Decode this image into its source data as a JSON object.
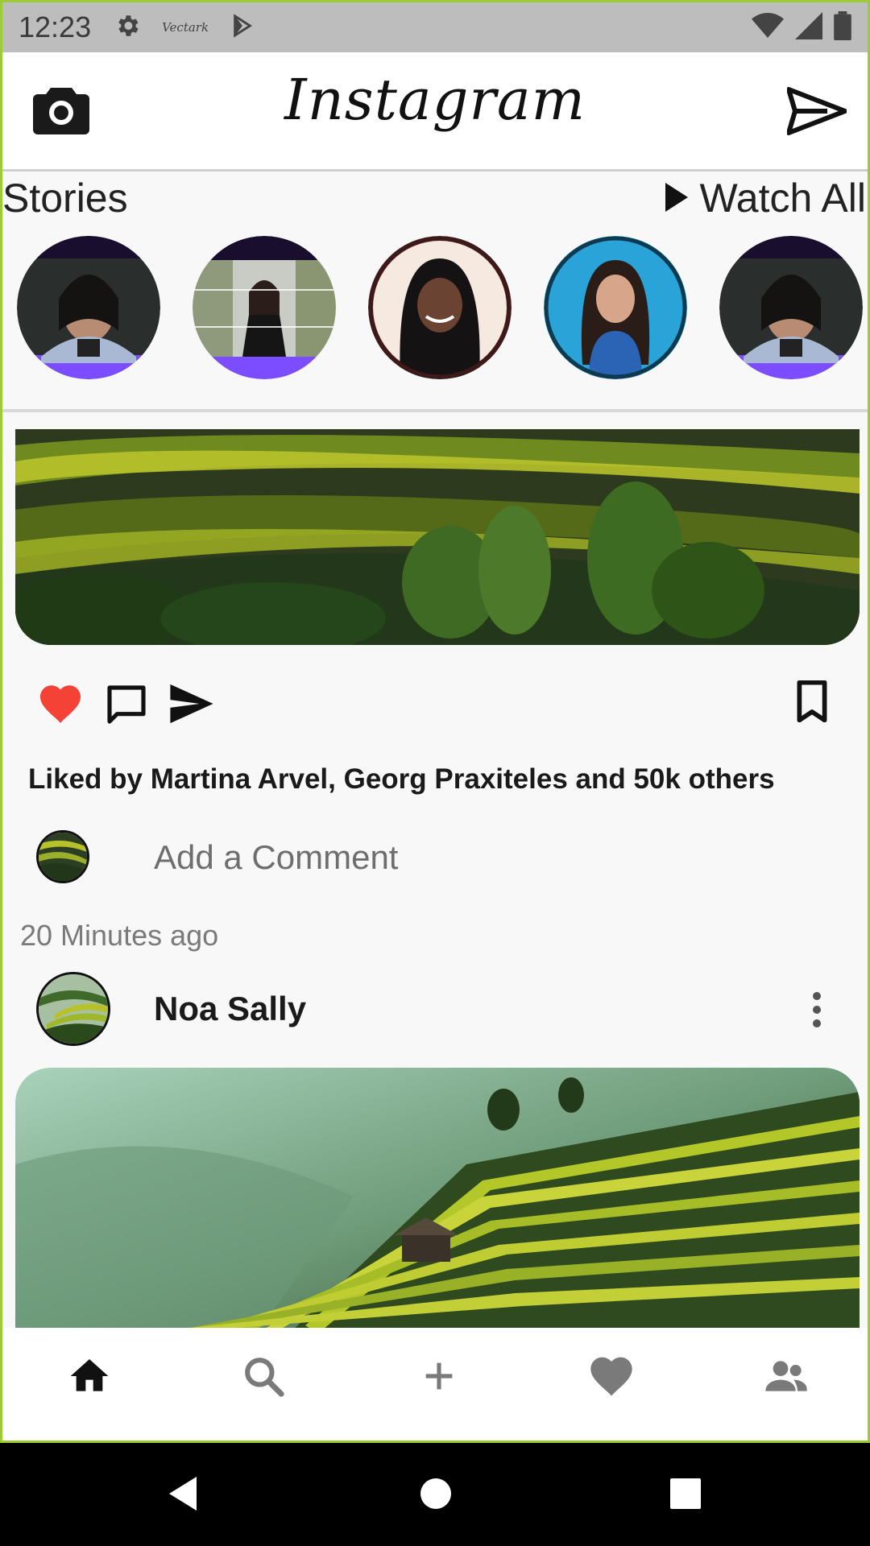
{
  "status_bar": {
    "time": "12:23",
    "icons": [
      "gear-icon",
      "vectark-icon",
      "play-store-icon",
      "wifi-icon",
      "signal-icon",
      "battery-icon"
    ],
    "vectark_label": "Vectark"
  },
  "app_bar": {
    "title": "Instagram",
    "left_icon": "camera-icon",
    "right_icon": "send-icon"
  },
  "stories": {
    "title": "Stories",
    "watch_all_label": "Watch All",
    "items": [
      {
        "name": "story-1",
        "ring": "#7c4dff"
      },
      {
        "name": "story-2",
        "ring": "#7c4dff"
      },
      {
        "name": "story-3",
        "ring": "#4a1f1f"
      },
      {
        "name": "story-4",
        "ring": "#0d3a4f"
      },
      {
        "name": "story-5",
        "ring": "#7c4dff"
      }
    ]
  },
  "post": {
    "liked_by": "Liked by Martina Arvel, Georg Praxiteles and 50k others",
    "comment_placeholder": "Add a Comment",
    "time_ago": "20 Minutes ago",
    "actions": [
      "heart-icon",
      "comment-icon",
      "share-icon",
      "bookmark-icon"
    ],
    "like_color": "#f44336"
  },
  "next_post": {
    "author": "Noa Sally"
  },
  "bottom_nav": {
    "items": [
      "home-icon",
      "search-icon",
      "add-icon",
      "heart-icon",
      "people-icon"
    ]
  },
  "colors": {
    "accent_border": "#9ccc33",
    "status_bar_bg": "#bdbdbd",
    "story_ring": "#7c4dff"
  }
}
